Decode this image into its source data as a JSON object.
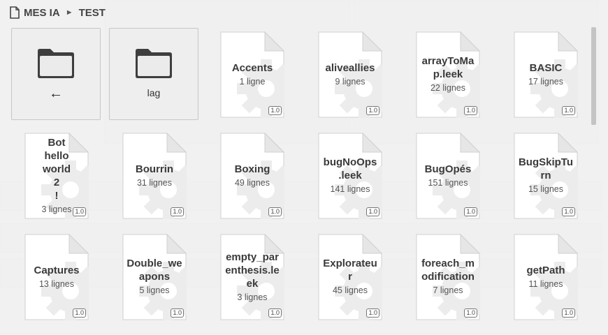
{
  "breadcrumb": {
    "root": "MES IA",
    "separator": "►",
    "current": "TEST"
  },
  "folders": [
    {
      "label": "←",
      "icon": "folder-icon",
      "kind": "parent"
    },
    {
      "label": "lag",
      "icon": "folder-icon",
      "kind": "folder"
    }
  ],
  "files": [
    {
      "name": "Accents",
      "lines": "1 ligne",
      "version": "1.0"
    },
    {
      "name": "aliveallies",
      "lines": "9 lignes",
      "version": "1.0"
    },
    {
      "name": "arrayToMa p.leek",
      "lines": "22 lignes",
      "version": "1.0"
    },
    {
      "name": "BASIC",
      "lines": "17 lignes",
      "version": "1.0"
    },
    {
      "name": "Bot hello world 2 !",
      "lines": "3 lignes",
      "version": "1.0"
    },
    {
      "name": "Bourrin",
      "lines": "31 lignes",
      "version": "1.0"
    },
    {
      "name": "Boxing",
      "lines": "49 lignes",
      "version": "1.0"
    },
    {
      "name": "bugNoOps .leek",
      "lines": "141 lignes",
      "version": "1.0"
    },
    {
      "name": "BugOpés",
      "lines": "151 lignes",
      "version": "1.0"
    },
    {
      "name": "BugSkipTu rn",
      "lines": "15 lignes",
      "version": "1.0"
    },
    {
      "name": "Captures",
      "lines": "13 lignes",
      "version": "1.0"
    },
    {
      "name": "Double_we apons",
      "lines": "5 lignes",
      "version": "1.0"
    },
    {
      "name": "empty_par enthesis.le ek",
      "lines": "3 lignes",
      "version": "1.0"
    },
    {
      "name": "Explorateu r",
      "lines": "45 lignes",
      "version": "1.0"
    },
    {
      "name": "foreach_m odification",
      "lines": "7 lignes",
      "version": "1.0"
    },
    {
      "name": "getPath",
      "lines": "11 lignes",
      "version": "1.0"
    }
  ],
  "colors": {
    "sheet_fill": "#ffffff",
    "sheet_stroke": "#d0d0d0",
    "gear": "#ececec",
    "text": "#3a3a3a"
  }
}
